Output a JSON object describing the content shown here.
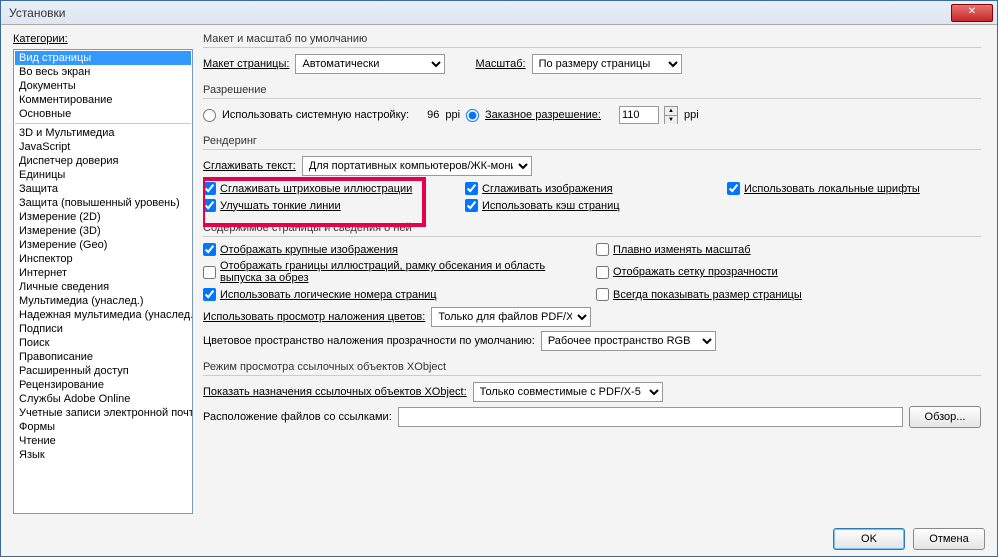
{
  "window_title": "Установки",
  "sidebar": {
    "label": "Категории:",
    "groups": [
      [
        "Вид страницы",
        "Во весь экран",
        "Документы",
        "Комментирование",
        "Основные"
      ],
      [
        "3D и Мультимедиа",
        "JavaScript",
        "Диспетчер доверия",
        "Единицы",
        "Защита",
        "Защита (повышенный уровень)",
        "Измерение (2D)",
        "Измерение (3D)",
        "Измерение (Geo)",
        "Инспектор",
        "Интернет",
        "Личные сведения",
        "Мультимедиа (унаслед.)",
        "Надежная мультимедиа (унаслед.)",
        "Подписи",
        "Поиск",
        "Правописание",
        "Расширенный доступ",
        "Рецензирование",
        "Службы Adobe Online",
        "Учетные записи электронной почты",
        "Формы",
        "Чтение",
        "Язык"
      ]
    ],
    "selected": "Вид страницы"
  },
  "sec_layout": {
    "title": "Макет и масштаб по умолчанию",
    "layout_label": "Макет страницы:",
    "layout_value": "Автоматически",
    "zoom_label": "Масштаб:",
    "zoom_value": "По размеру страницы"
  },
  "sec_res": {
    "title": "Разрешение",
    "sys_label": "Использовать системную настройку:",
    "sys_value": "96",
    "ppi": "ppi",
    "custom_label": "Заказное разрешение:",
    "custom_value": "110"
  },
  "sec_render": {
    "title": "Рендеринг",
    "smooth_text_label": "Сглаживать текст:",
    "smooth_text_value": "Для портативных компьютеров/ЖК-мониторов",
    "c1": "Сглаживать штриховые иллюстрации",
    "c2": "Сглаживать изображения",
    "c3": "Использовать локальные шрифты",
    "c4": "Улучшать тонкие линии",
    "c5": "Использовать кэш страниц"
  },
  "sec_page": {
    "title": "Содержимое страницы и сведения о ней",
    "c1": "Отображать крупные изображения",
    "c2": "Плавно изменять масштаб",
    "c3": "Отображать границы иллюстраций, рамку обсекания и область выпуска за обрез",
    "c4": "Отображать сетку прозрачности",
    "c5": "Использовать логические номера страниц",
    "c6": "Всегда показывать размер страницы",
    "overlay_label": "Использовать просмотр наложения цветов:",
    "overlay_value": "Только для файлов PDF/X",
    "cs_label": "Цветовое пространство наложения прозрачности по умолчанию:",
    "cs_value": "Рабочее пространство RGB"
  },
  "sec_xobj": {
    "title": "Режим просмотра ссылочных объектов XObject",
    "show_label": "Показать назначения ссылочных объектов XObject:",
    "show_value": "Только совместимые с PDF/X-5",
    "loc_label": "Расположение файлов со ссылками:",
    "loc_value": "",
    "browse": "Обзор..."
  },
  "footer": {
    "ok": "OK",
    "cancel": "Отмена"
  }
}
